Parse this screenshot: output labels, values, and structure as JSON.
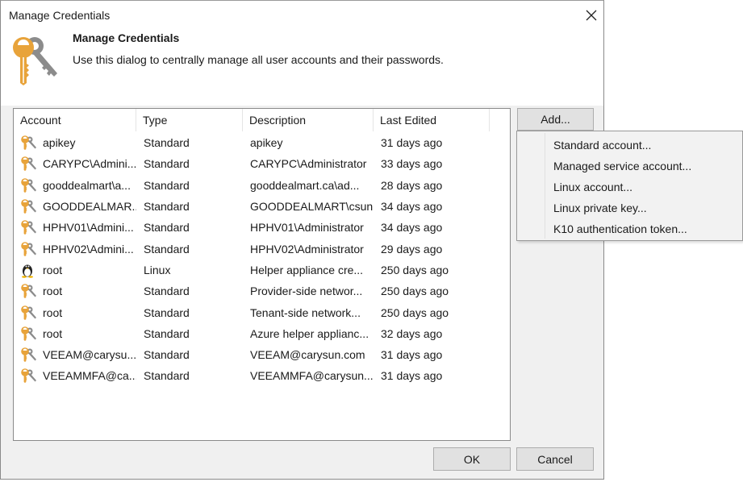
{
  "window": {
    "title": "Manage Credentials",
    "close_icon": "close-icon"
  },
  "header": {
    "icon": "keys-icon",
    "title": "Manage Credentials",
    "description": "Use this dialog to centrally manage all user accounts and their passwords."
  },
  "table": {
    "columns": [
      "Account",
      "Type",
      "Description",
      "Last Edited"
    ],
    "rows": [
      {
        "icon": "key-icon",
        "account": "apikey",
        "type": "Standard",
        "description": "apikey",
        "last_edited": "31 days ago"
      },
      {
        "icon": "key-icon",
        "account": "CARYPC\\Admini...",
        "type": "Standard",
        "description": "CARYPC\\Administrator",
        "last_edited": "33 days ago"
      },
      {
        "icon": "key-icon",
        "account": "gooddealmart\\a...",
        "type": "Standard",
        "description": "gooddealmart.ca\\ad...",
        "last_edited": "28 days ago"
      },
      {
        "icon": "key-icon",
        "account": "GOODDEALMAR...",
        "type": "Standard",
        "description": "GOODDEALMART\\csun",
        "last_edited": "34 days ago"
      },
      {
        "icon": "key-icon",
        "account": "HPHV01\\Admini...",
        "type": "Standard",
        "description": "HPHV01\\Administrator",
        "last_edited": "34 days ago"
      },
      {
        "icon": "key-icon",
        "account": "HPHV02\\Admini...",
        "type": "Standard",
        "description": "HPHV02\\Administrator",
        "last_edited": "29 days ago"
      },
      {
        "icon": "linux-penguin-icon",
        "account": "root",
        "type": "Linux",
        "description": "Helper appliance cre...",
        "last_edited": "250 days ago"
      },
      {
        "icon": "key-icon",
        "account": "root",
        "type": "Standard",
        "description": "Provider-side networ...",
        "last_edited": "250 days ago"
      },
      {
        "icon": "key-icon",
        "account": "root",
        "type": "Standard",
        "description": "Tenant-side network...",
        "last_edited": "250 days ago"
      },
      {
        "icon": "key-icon",
        "account": "root",
        "type": "Standard",
        "description": "Azure helper applianc...",
        "last_edited": "32 days ago"
      },
      {
        "icon": "key-icon",
        "account": "VEEAM@carysu...",
        "type": "Standard",
        "description": "VEEAM@carysun.com",
        "last_edited": "31 days ago"
      },
      {
        "icon": "key-icon",
        "account": "VEEAMMFA@ca...",
        "type": "Standard",
        "description": "VEEAMMFA@carysun...",
        "last_edited": "31 days ago"
      }
    ]
  },
  "buttons": {
    "add": "Add...",
    "ok": "OK",
    "cancel": "Cancel"
  },
  "add_menu": {
    "items": [
      "Standard account...",
      "Managed service account...",
      "Linux account...",
      "Linux private key...",
      "K10 authentication token..."
    ]
  },
  "colors": {
    "key_gold": "#e8a33a",
    "key_gray": "#8c8c8c",
    "dialog_bg": "#f0f0f0",
    "button_bg": "#e1e1e1"
  }
}
